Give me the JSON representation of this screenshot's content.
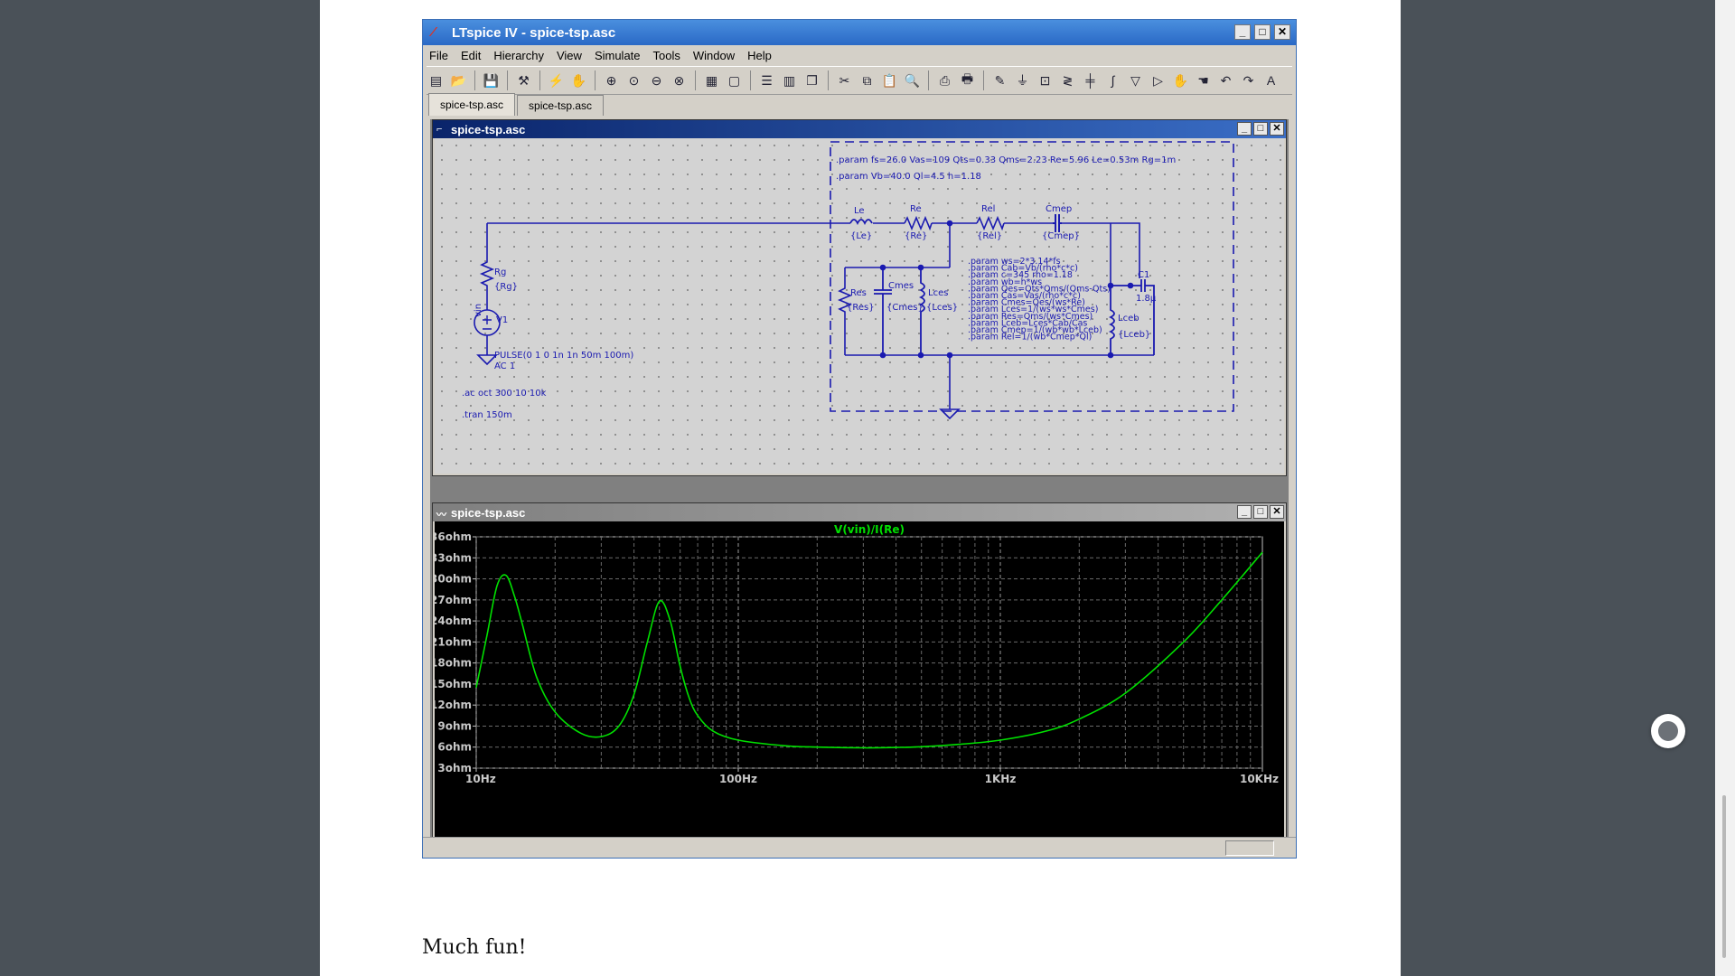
{
  "app": {
    "title": "LTspice IV - spice-tsp.asc",
    "menu": [
      "File",
      "Edit",
      "Hierarchy",
      "View",
      "Simulate",
      "Tools",
      "Window",
      "Help"
    ],
    "tabs": [
      "spice-tsp.asc",
      "spice-tsp.asc"
    ]
  },
  "schematic": {
    "window_title": "spice-tsp.asc",
    "param_line1": ".param fs=26.0 Vas=109 Qts=0.33 Qms=2.23 Re=5.96 Le=0.53m Rg=1m",
    "param_line2": ".param Vb=40.0 Ql=4.5 h=1.18",
    "param_block": [
      ".param ws=2*3.14*fs",
      ".param Cab=Vb/(rho*c*c)",
      ".param c=345 rho=1.18",
      ".param wb=h*ws",
      ".param Qes=Qts*Qms/(Qms-Qts)",
      ".param Cas=Vas/(rho*c*c)",
      ".param Cmes=Qes/(ws*Re)",
      ".param Lces=1/(ws*ws*Cmes)",
      ".param Res=Qms/(ws*Cmes)",
      ".param Lceb=Lces*Cab/Cas",
      ".param Cmep=1/(wb*wb*Lceb)",
      ".param Rel=1/(wb*Cmep*Ql)"
    ],
    "components": {
      "Le": {
        "name": "Le",
        "value": "{Le}"
      },
      "Re": {
        "name": "Re",
        "value": "{Re}"
      },
      "Rel": {
        "name": "Rel",
        "value": "{Rel}"
      },
      "Cmep": {
        "name": "Cmep",
        "value": "{Cmep}"
      },
      "Rg": {
        "name": "Rg",
        "value": "{Rg}"
      },
      "V1": {
        "name": "V1",
        "net": "vin",
        "value1": "PULSE(0 1 0 1n 1n 50m 100m)",
        "value2": "AC 1"
      },
      "Res": {
        "name": "Res",
        "value": "{Res}"
      },
      "Cmes": {
        "name": "Cmes",
        "value": "{Cmes}"
      },
      "Lces": {
        "name": "Lces",
        "value": "{Lces}"
      },
      "C1": {
        "name": "C1",
        "value": "1.8µ"
      },
      "Lceb": {
        "name": "Lceb",
        "value": "{Lceb}"
      }
    },
    "directive_ac": ".ac oct 300 10 10k",
    "directive_tran": ".tran 150m"
  },
  "waveform": {
    "window_title": "spice-tsp.asc",
    "trace_label": "V(vin)/I(Re)",
    "trace_color": "#00e000"
  },
  "chart_data": {
    "type": "line",
    "title": "V(vin)/I(Re)",
    "xscale": "log",
    "xlim": [
      10,
      10000
    ],
    "ylim": [
      3,
      36
    ],
    "x_ticks": [
      "10Hz",
      "100Hz",
      "1KHz",
      "10KHz"
    ],
    "y_ticks": [
      "36ohm",
      "33ohm",
      "30ohm",
      "27ohm",
      "24ohm",
      "21ohm",
      "18ohm",
      "15ohm",
      "12ohm",
      "9ohm",
      "6ohm",
      "3ohm"
    ],
    "grid": true,
    "series": [
      {
        "name": "V(vin)/I(Re)",
        "color": "#00e000",
        "x": [
          10,
          11,
          12,
          13,
          14,
          15,
          17,
          20,
          25,
          30,
          35,
          40,
          45,
          50,
          55,
          60,
          65,
          70,
          80,
          100,
          150,
          200,
          300,
          400,
          500,
          700,
          1000,
          1500,
          2000,
          3000,
          5000,
          7000,
          10000
        ],
        "y": [
          14.5,
          22,
          29,
          30.5,
          27.5,
          23.5,
          16,
          11,
          8,
          7.5,
          9,
          13.5,
          21,
          26.8,
          24,
          17.5,
          13,
          10.5,
          8.3,
          7,
          6.2,
          6,
          5.9,
          5.95,
          6.05,
          6.4,
          7,
          8.3,
          10,
          13.7,
          21,
          27,
          33.8
        ]
      }
    ]
  },
  "page": {
    "closing_text": "Much fun!"
  }
}
